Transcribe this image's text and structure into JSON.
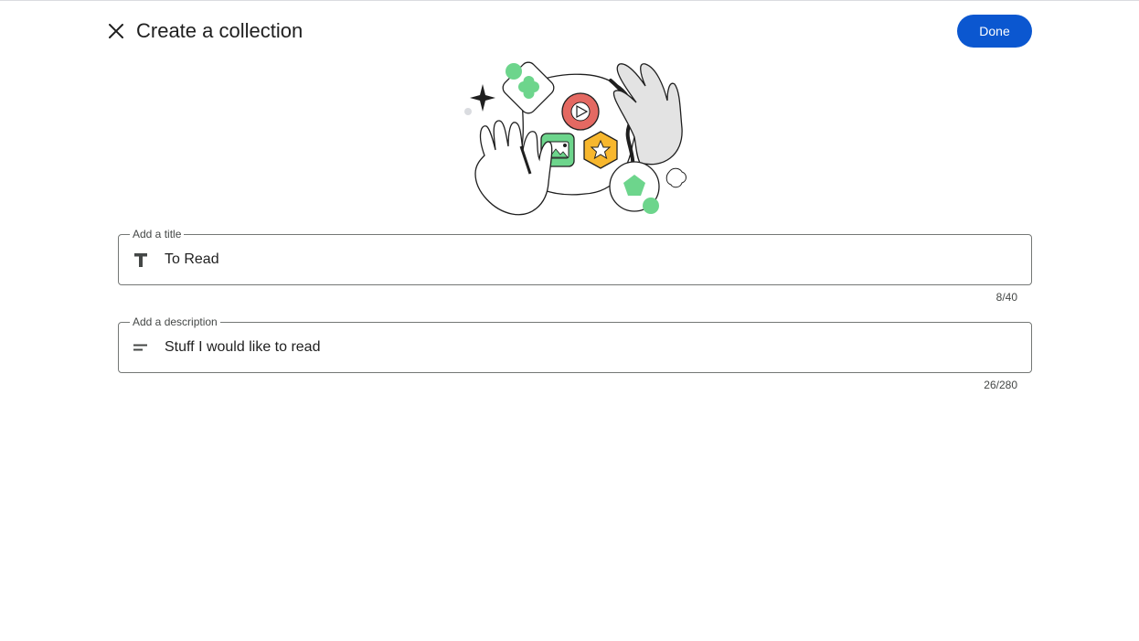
{
  "header": {
    "close_icon": "close-icon",
    "title": "Create a collection",
    "done_label": "Done"
  },
  "colors": {
    "primary": "#0b57d0",
    "green": "#6dd58c",
    "red": "#e46962",
    "yellow": "#f7b72e",
    "outline": "#747775"
  },
  "title_field": {
    "label": "Add a title",
    "icon": "text-format-icon",
    "value": "To Read",
    "counter": "8/40"
  },
  "description_field": {
    "label": "Add a description",
    "icon": "short-text-icon",
    "value": "Stuff I would like to read",
    "counter": "26/280"
  }
}
